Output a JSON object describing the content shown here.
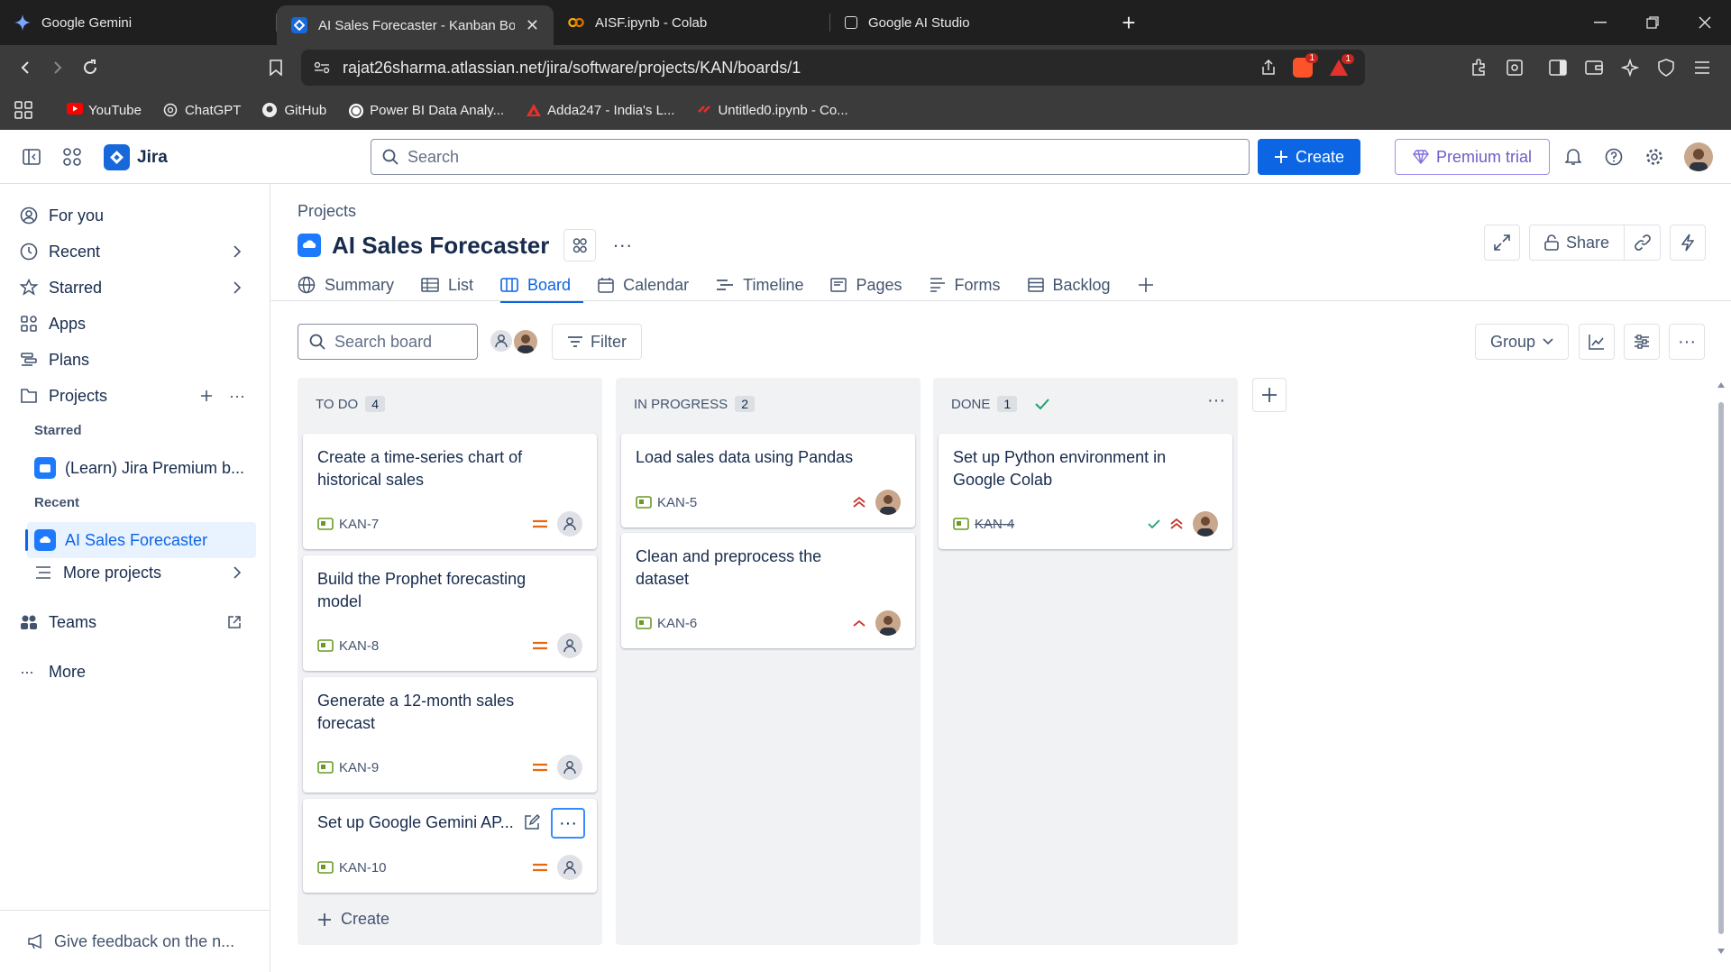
{
  "browser": {
    "tabs": [
      {
        "title": "Google Gemini",
        "icon": "gemini-icon",
        "active": false
      },
      {
        "title": "AI Sales Forecaster - Kanban Boa",
        "icon": "jira-icon",
        "active": true
      },
      {
        "title": "AISF.ipynb - Colab",
        "icon": "colab-icon",
        "active": false
      },
      {
        "title": "Google AI Studio",
        "icon": "ai-studio-icon",
        "active": false
      }
    ],
    "url": "rajat26sharma.atlassian.net/jira/software/projects/KAN/boards/1",
    "shield_badge": "1",
    "alert_badge": "1",
    "bookmarks": [
      {
        "label": "YouTube",
        "icon": "youtube-icon"
      },
      {
        "label": "ChatGPT",
        "icon": "chatgpt-icon"
      },
      {
        "label": "GitHub",
        "icon": "github-icon"
      },
      {
        "label": "Power BI Data Analy...",
        "icon": "powerbi-icon"
      },
      {
        "label": "Adda247 - India's L...",
        "icon": "adda-icon"
      },
      {
        "label": "Untitled0.ipynb - Co...",
        "icon": "colab-icon"
      }
    ]
  },
  "header": {
    "app_name": "Jira",
    "search_placeholder": "Search",
    "create_label": "Create",
    "premium_label": "Premium trial"
  },
  "sidebar": {
    "items": [
      {
        "label": "For you",
        "icon": "user-circle-icon"
      },
      {
        "label": "Recent",
        "icon": "clock-icon"
      },
      {
        "label": "Starred",
        "icon": "star-icon"
      },
      {
        "label": "Apps",
        "icon": "apps-icon"
      },
      {
        "label": "Plans",
        "icon": "plans-icon"
      },
      {
        "label": "Projects",
        "icon": "projects-icon"
      }
    ],
    "starred_heading": "Starred",
    "starred_project": "(Learn) Jira Premium b...",
    "recent_heading": "Recent",
    "recent_project": "AI Sales Forecaster",
    "more_projects": "More projects",
    "teams": "Teams",
    "more": "More",
    "feedback": "Give feedback on the n..."
  },
  "project": {
    "breadcrumb": "Projects",
    "title": "AI Sales Forecaster",
    "share_label": "Share",
    "tabs": [
      {
        "label": "Summary",
        "icon": "globe-icon",
        "active": false
      },
      {
        "label": "List",
        "icon": "list-icon",
        "active": false
      },
      {
        "label": "Board",
        "icon": "board-icon",
        "active": true
      },
      {
        "label": "Calendar",
        "icon": "calendar-icon",
        "active": false
      },
      {
        "label": "Timeline",
        "icon": "timeline-icon",
        "active": false
      },
      {
        "label": "Pages",
        "icon": "pages-icon",
        "active": false
      },
      {
        "label": "Forms",
        "icon": "forms-icon",
        "active": false
      },
      {
        "label": "Backlog",
        "icon": "backlog-icon",
        "active": false
      }
    ]
  },
  "board": {
    "search_placeholder": "Search board",
    "filter_label": "Filter",
    "group_label": "Group",
    "create_label": "Create",
    "columns": [
      {
        "name": "TO DO",
        "count": "4",
        "cards": [
          {
            "title": "Create a time-series chart of historical sales",
            "key": "KAN-7",
            "priority": "medium",
            "assignee": "unassigned"
          },
          {
            "title": "Build the Prophet forecasting model",
            "key": "KAN-8",
            "priority": "medium",
            "assignee": "unassigned"
          },
          {
            "title": "Generate a 12-month sales forecast",
            "key": "KAN-9",
            "priority": "medium",
            "assignee": "unassigned"
          },
          {
            "title": "Set up Google Gemini AP...",
            "key": "KAN-10",
            "priority": "medium",
            "assignee": "unassigned"
          }
        ]
      },
      {
        "name": "IN PROGRESS",
        "count": "2",
        "cards": [
          {
            "title": "Load sales data using Pandas",
            "key": "KAN-5",
            "priority": "highest",
            "assignee": "user"
          },
          {
            "title": "Clean and preprocess the dataset",
            "key": "KAN-6",
            "priority": "high",
            "assignee": "user"
          }
        ]
      },
      {
        "name": "DONE",
        "count": "1",
        "cards": [
          {
            "title": "Set up Python environment in Google Colab",
            "key": "KAN-4",
            "priority": "highest",
            "assignee": "user",
            "done": true
          }
        ]
      }
    ]
  },
  "colors": {
    "primary": "#0c66e4",
    "medium_priority": "#e56910",
    "high_priority": "#c9372c",
    "done": "#22a06b",
    "premium": "#6e5dc6"
  }
}
